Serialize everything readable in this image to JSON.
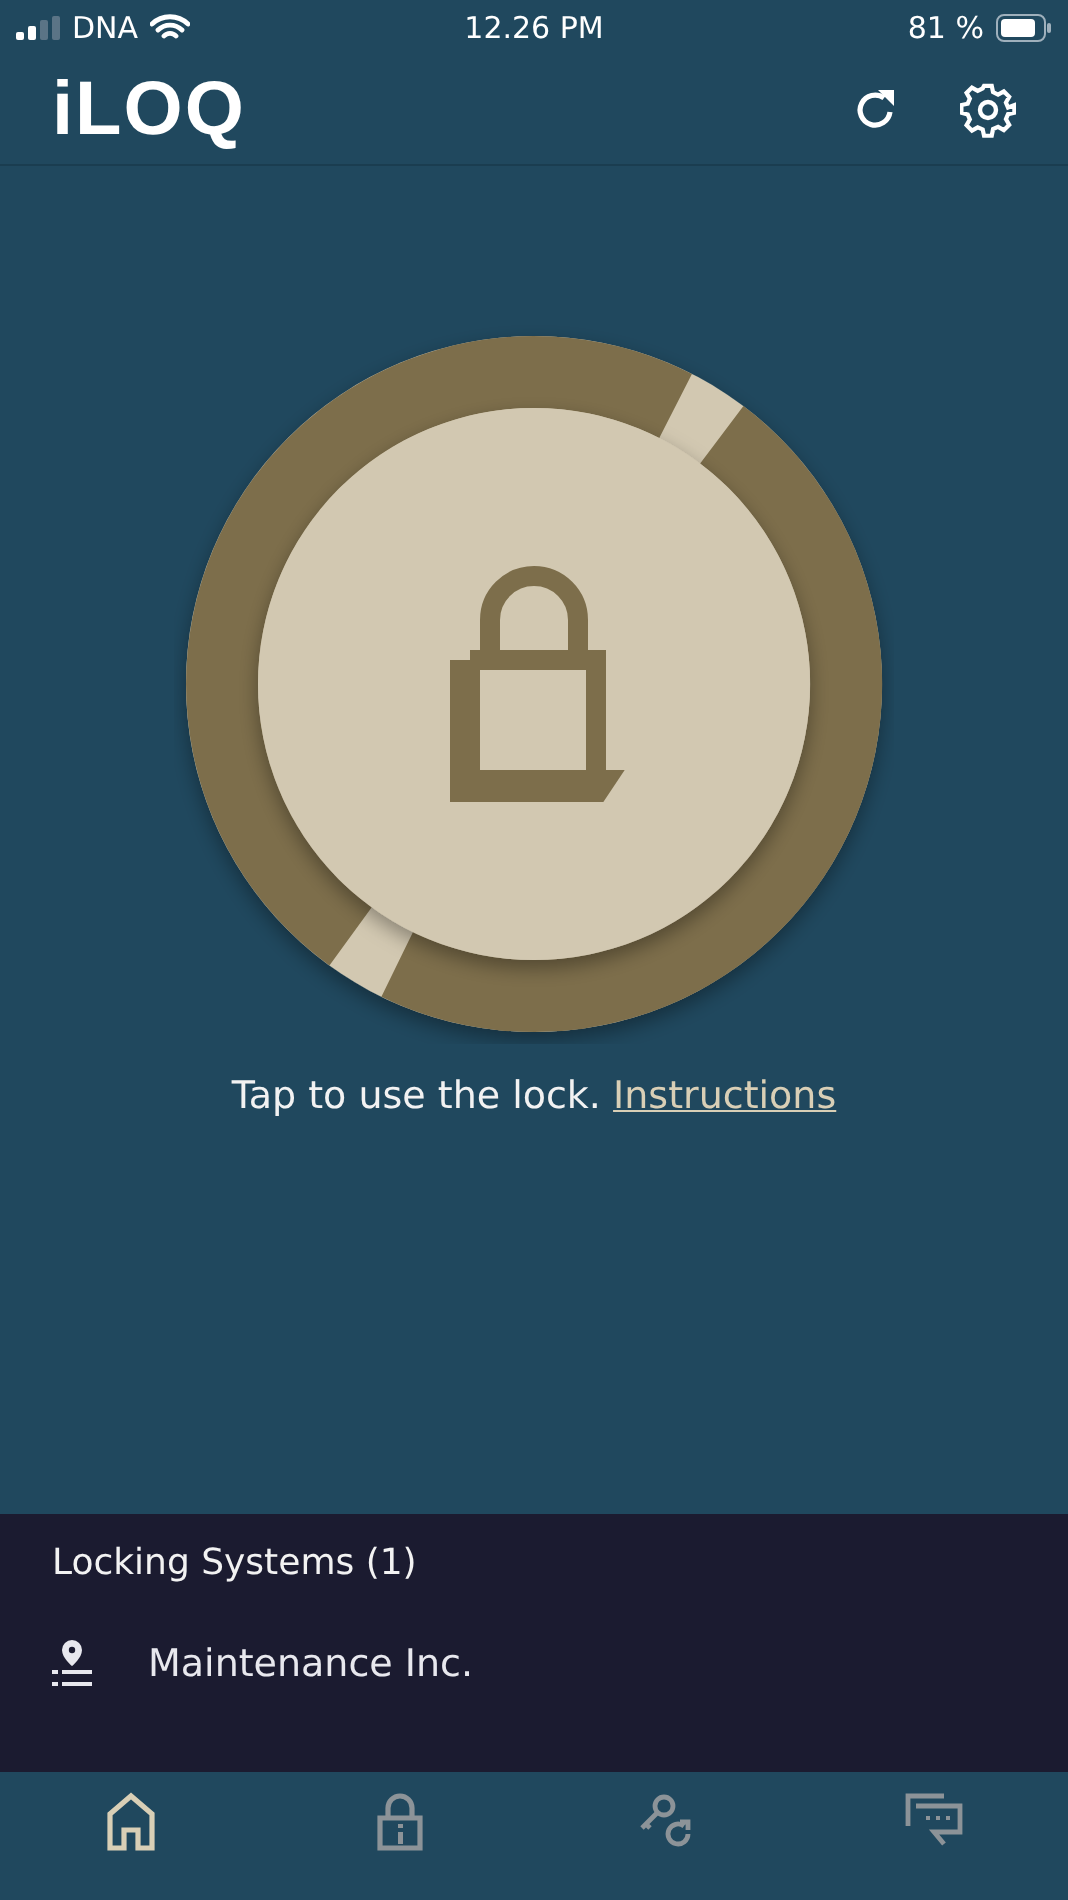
{
  "status_bar": {
    "carrier": "DNA",
    "time": "12.26 PM",
    "battery": "81 %"
  },
  "header": {
    "logo": "iLOQ"
  },
  "lock": {
    "prompt": "Tap to use the lock.",
    "link": "Instructions"
  },
  "locking_systems": {
    "title": "Locking Systems (1)",
    "items": [
      {
        "name": "Maintenance Inc."
      }
    ]
  },
  "tabs": [
    {
      "kind": "home",
      "selected": true
    },
    {
      "kind": "lock",
      "selected": false
    },
    {
      "kind": "keys",
      "selected": false
    },
    {
      "kind": "messages",
      "selected": false
    }
  ]
}
